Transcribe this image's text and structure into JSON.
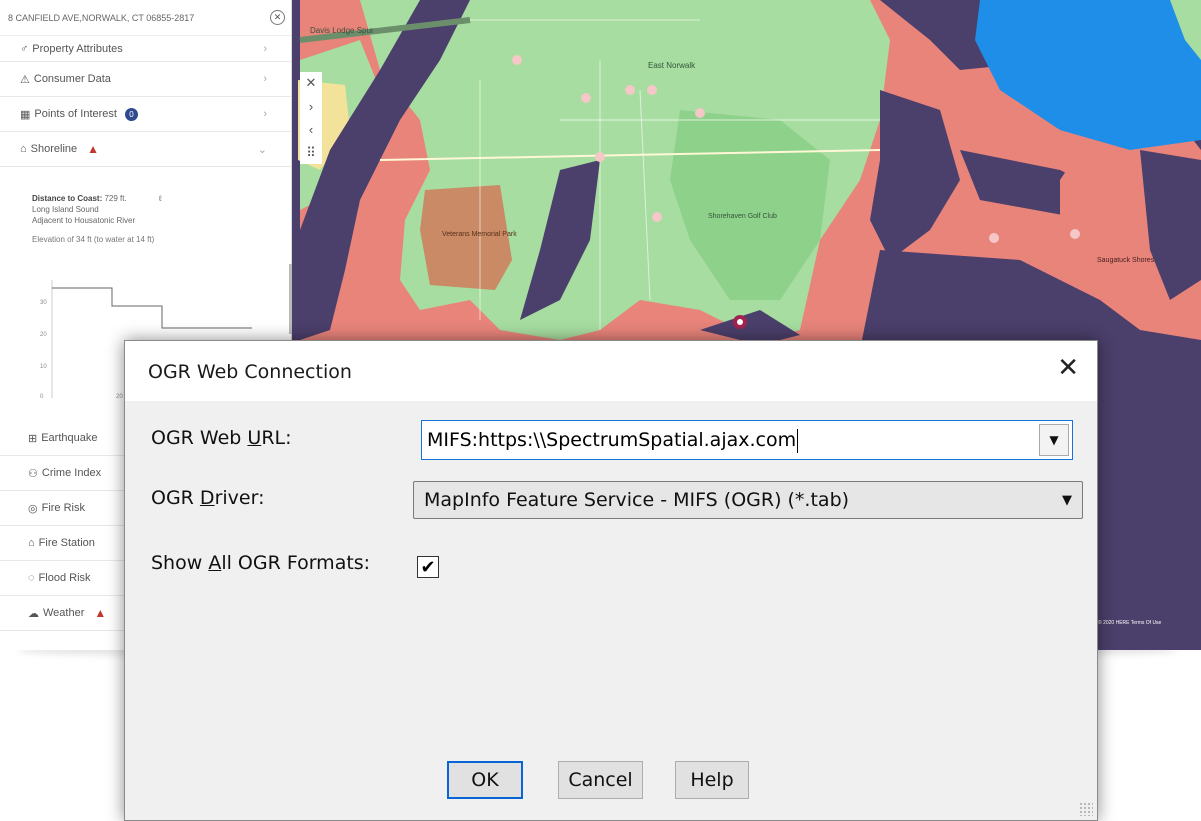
{
  "background_app": {
    "address": "8 CANFIELD AVE,NORWALK, CT  06855-2817",
    "menu_top": [
      {
        "label": "Property Attributes"
      },
      {
        "label": "Consumer Data"
      },
      {
        "label": "Points of Interest",
        "badge": "0"
      },
      {
        "label": "Shoreline",
        "warning": true
      }
    ],
    "shoreline": {
      "distance_label": "Distance to Coast:",
      "distance_value": "729 ft.",
      "water_body": "Long Island Sound",
      "adjacent": "Adjacent to Housatonic River",
      "elevation": "Elevation of 34 ft (to water at 14 ft)",
      "chart_ticks": [
        "30",
        "20",
        "10",
        "0"
      ],
      "chart_x_tick": "20"
    },
    "menu_bottom": [
      {
        "label": "Earthquake"
      },
      {
        "label": "Crime Index"
      },
      {
        "label": "Fire Risk"
      },
      {
        "label": "Fire Station"
      },
      {
        "label": "Flood Risk"
      },
      {
        "label": "Weather",
        "warning": true
      }
    ],
    "map": {
      "labels": [
        "East Norwalk",
        "Saugatuck Shores",
        "Shorehaven Golf Club",
        "Veterans Memorial Park",
        "Davis Lodge Spur"
      ],
      "attribution": "© 2020 HERE Terms Of Use",
      "colors": {
        "water": "#4b3f6b",
        "land": "#a7dda0",
        "risk": "#e8847a",
        "park": "#c98a65",
        "sea": "#1e8ee8"
      }
    }
  },
  "dialog": {
    "title": "OGR Web Connection",
    "url_label_pre": "OGR Web ",
    "url_label_u": "U",
    "url_label_post": "RL:",
    "url_value": "MIFS:https:\\\\SpectrumSpatial.ajax.com",
    "driver_label_pre": "OGR ",
    "driver_label_u": "D",
    "driver_label_post": "river:",
    "driver_value": "MapInfo Feature Service  - MIFS (OGR) (*.tab)",
    "show_label_pre": "Show ",
    "show_label_u": "A",
    "show_label_post": "ll OGR Formats:",
    "show_all_checked": true,
    "ok_label": "OK",
    "cancel_label": "Cancel",
    "help_label": "Help"
  }
}
